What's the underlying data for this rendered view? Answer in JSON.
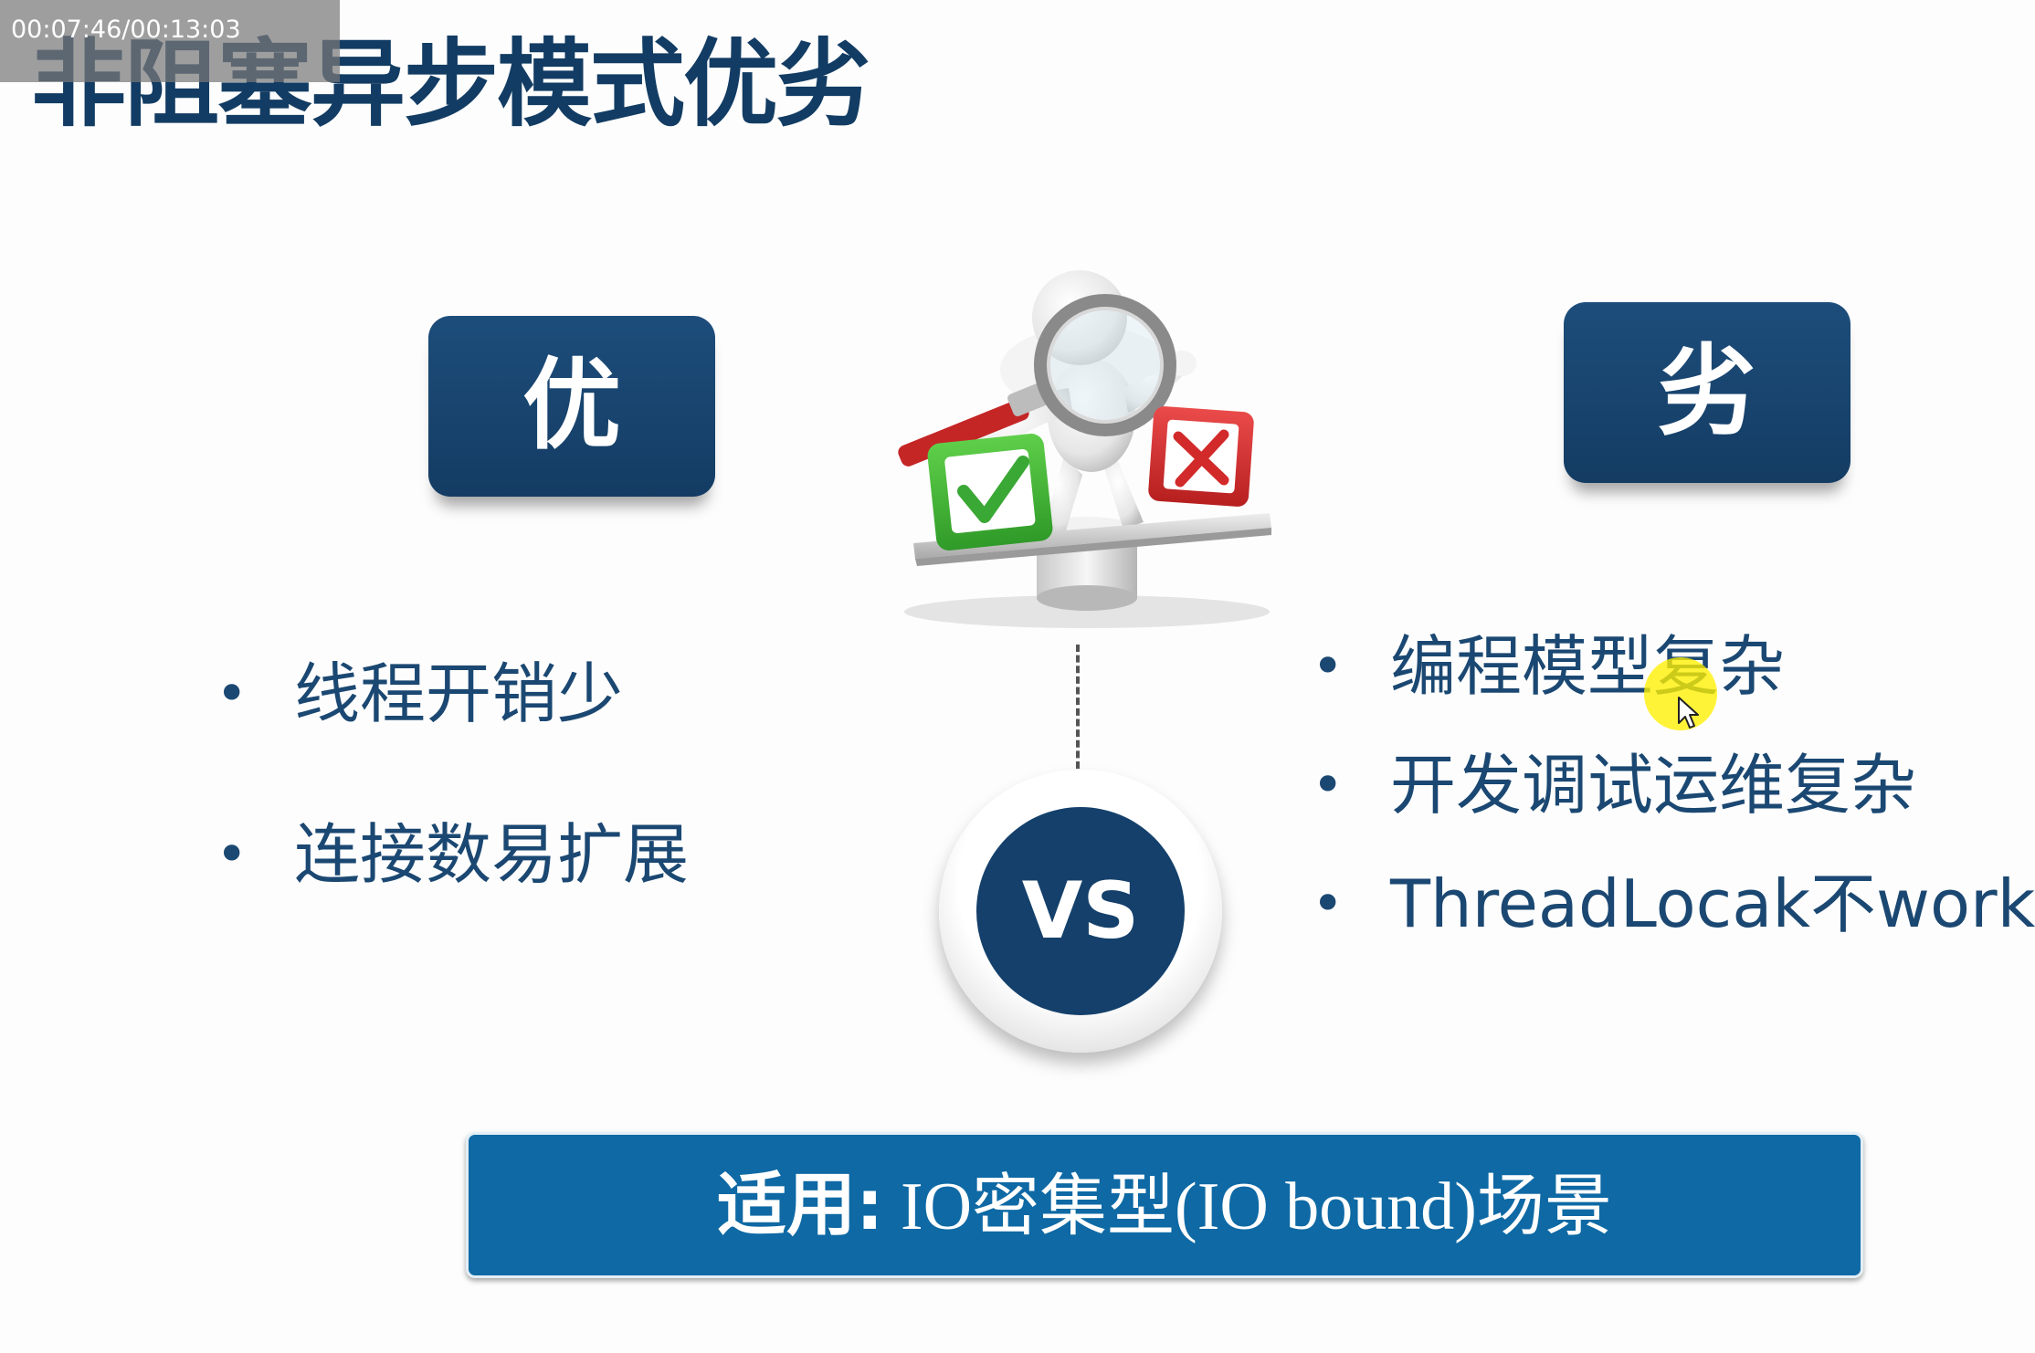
{
  "timecode": "00:07:46/00:13:03",
  "title": "非阻塞异步模式优劣",
  "pros": {
    "badge": "优",
    "items": [
      "线程开销少",
      "连接数易扩展"
    ]
  },
  "cons": {
    "badge": "劣",
    "items": [
      "编程模型复杂",
      "开发调试运维复杂",
      "ThreadLocak不work"
    ]
  },
  "bullet_glyph": "•",
  "vs_label": "VS",
  "banner": {
    "label": "适用:",
    "text": " IO密集型(IO bound)场景"
  },
  "colors": {
    "title": "#123c63",
    "badge": "#174671",
    "list_text": "#1b4872",
    "banner": "#0e69a4",
    "check": "#3aa834",
    "cross": "#d22a2a",
    "cursor_highlight": "#fff000"
  },
  "icons": {
    "illustration": "figure-with-magnifier-balancing-check-and-cross",
    "cursor": "mouse-pointer-icon"
  }
}
